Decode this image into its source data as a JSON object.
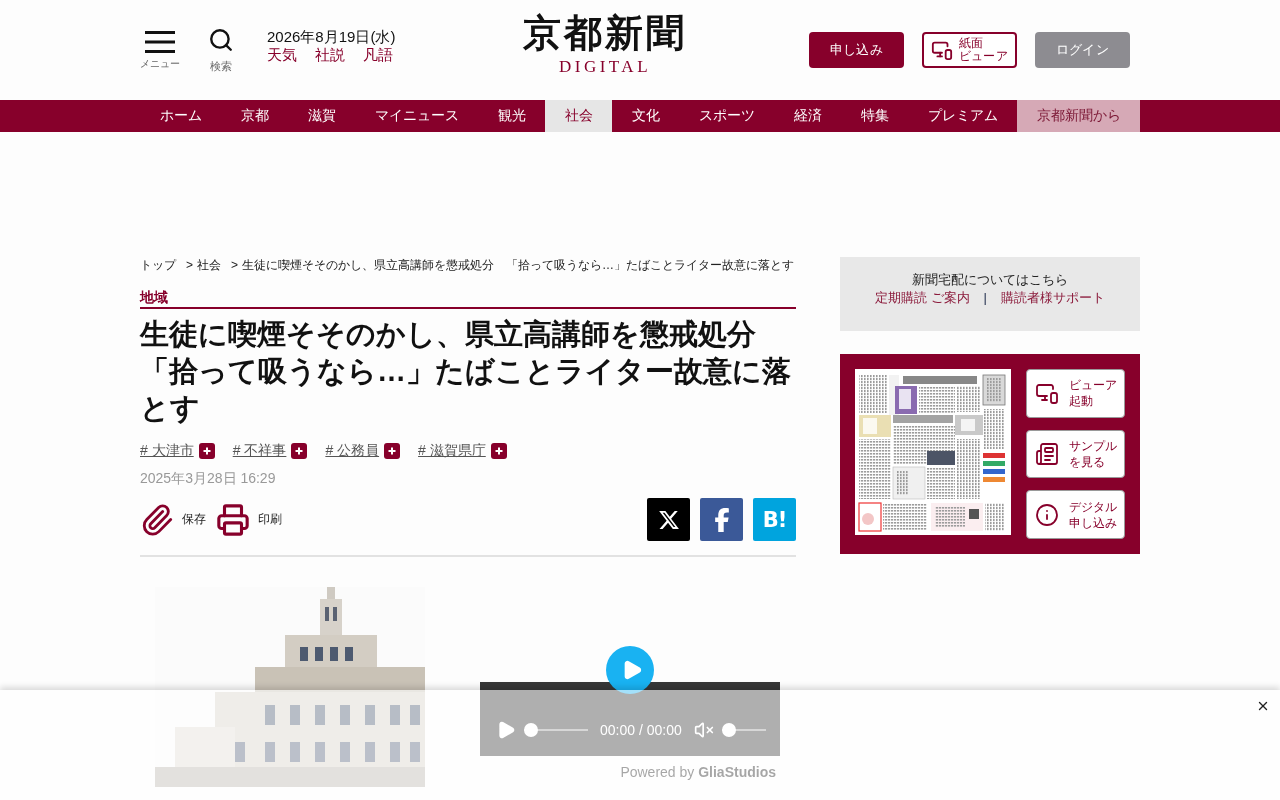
{
  "header": {
    "menu_label": "メニュー",
    "search_label": "検索",
    "date": "2026年8月19日(水)",
    "quick_links": [
      "天気",
      "社説",
      "凡語"
    ],
    "logo": {
      "title": "京都新聞",
      "subtitle": "DIGITAL"
    },
    "buttons": [
      {
        "kind": "primary",
        "label": [
          "申し込み"
        ]
      },
      {
        "kind": "viewer",
        "label": [
          "紙面",
          "ビューア"
        ]
      },
      {
        "kind": "muted",
        "label": [
          "ログイン"
        ]
      }
    ]
  },
  "nav": [
    {
      "label": "ホーム",
      "kind": "section",
      "selected": false
    },
    {
      "label": "京都",
      "kind": "section",
      "selected": false
    },
    {
      "label": "滋賀",
      "kind": "section",
      "selected": false
    },
    {
      "label": "マイニュース",
      "kind": "section",
      "selected": false
    },
    {
      "label": "観光",
      "kind": "section",
      "selected": false
    },
    {
      "label": "社会",
      "kind": "section",
      "selected": true
    },
    {
      "label": "文化",
      "kind": "section",
      "selected": false
    },
    {
      "label": "スポーツ",
      "kind": "section",
      "selected": false
    },
    {
      "label": "経済",
      "kind": "section",
      "selected": false
    },
    {
      "label": "特集",
      "kind": "section",
      "selected": false
    },
    {
      "label": "プレミアム",
      "kind": "section",
      "selected": false
    },
    {
      "label": "京都新聞から",
      "kind": "promo",
      "selected": false
    }
  ],
  "breadcrumb": [
    {
      "label": "トップ"
    },
    {
      "separator": ">",
      "label": "社会"
    },
    {
      "separator": ">",
      "label": "生徒に喫煙そそのかし、県立高講師を懲戒処分　「拾って吸うなら…」たばことライター故意に落とす"
    }
  ],
  "article": {
    "category": "地域",
    "title": "生徒に喫煙そそのかし、県立高講師を懲戒処分「拾って吸うなら…」たばことライター故意に落とす",
    "tags": [
      "# 大津市",
      "# 不祥事",
      "# 公務員",
      "# 滋賀県庁"
    ],
    "published": "2025年3月28日 16:29",
    "actions": [
      {
        "kind": "save",
        "label": "保存"
      },
      {
        "kind": "print",
        "label": "印刷"
      }
    ],
    "share": [
      {
        "kind": "x"
      },
      {
        "kind": "facebook"
      },
      {
        "kind": "hatena",
        "label": "B!"
      }
    ]
  },
  "media": {
    "video": {
      "seek": {
        "level": 0
      },
      "time": "00:00 / 00:00",
      "muted": true,
      "volume": {
        "level": 0
      },
      "credit": "Powered by **GliaStudios**"
    }
  },
  "sidebar": {
    "delivery": {
      "heading": "新聞宅配についてはこちら",
      "links": [
        "定期購読 ご案内",
        "購読者様サポート"
      ],
      "divider": "|"
    },
    "viewer_panel": {
      "buttons": [
        {
          "kind": "viewer",
          "label": "ビューア起動"
        },
        {
          "kind": "sample",
          "label": "サンプルを見る"
        },
        {
          "kind": "apply",
          "label": "デジタル申し込み"
        }
      ]
    }
  }
}
